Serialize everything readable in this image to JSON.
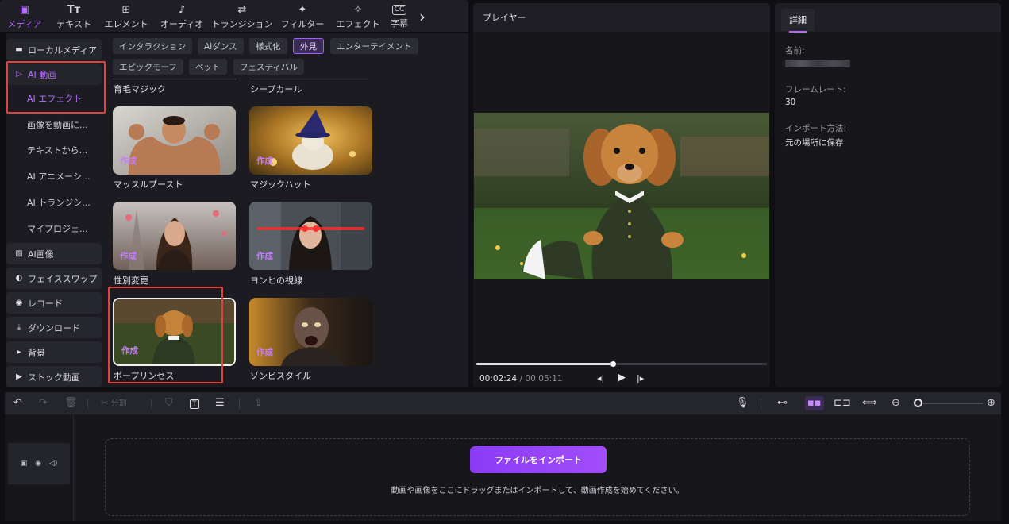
{
  "top_tabs": [
    {
      "icon": "media-icon",
      "glyph": "🖼",
      "label": "メディア",
      "active": true
    },
    {
      "icon": "text-icon",
      "glyph": "T",
      "label": "テキスト"
    },
    {
      "icon": "elements-icon",
      "glyph": "◫",
      "label": "エレメント"
    },
    {
      "icon": "audio-icon",
      "glyph": "♪",
      "label": "オーディオ"
    },
    {
      "icon": "transition-icon",
      "glyph": "⇆",
      "label": "トランジション"
    },
    {
      "icon": "filter-icon",
      "glyph": "✦",
      "label": "フィルター"
    },
    {
      "icon": "effect-icon",
      "glyph": "✧",
      "label": "エフェクト"
    },
    {
      "icon": "subtitle-icon",
      "glyph": "CC",
      "label": "字幕"
    }
  ],
  "sidebar": {
    "local_media": "ローカルメディア",
    "ai_video": "AI 動画",
    "ai_effect": "AI エフェクト",
    "image_to_video": "画像を動画に...",
    "text_to": "テキストから...",
    "ai_animation": "AI アニメーシ...",
    "ai_transition": "AI トランジシ...",
    "my_project": "マイプロジェ...",
    "ai_image": "AI画像",
    "face_swap": "フェイススワップ",
    "record": "レコード",
    "download": "ダウンロード",
    "background": "背景",
    "stock_video": "ストック動画"
  },
  "filters": {
    "row1": [
      "インタラクション",
      "AIダンス",
      "様式化",
      "外見",
      "エンターテイメント"
    ],
    "row2": [
      "エピックモーフ",
      "ペット",
      "フェスティバル"
    ],
    "selected": "外見"
  },
  "effects": {
    "top_labels": [
      "育毛マジック",
      "シープカール"
    ],
    "make_label": "作成",
    "items": [
      {
        "name": "マッスルブースト"
      },
      {
        "name": "マジックハット"
      },
      {
        "name": "性別変更"
      },
      {
        "name": "ヨンヒの視線"
      },
      {
        "name": "ポープリンセス"
      },
      {
        "name": "ゾンビスタイル"
      }
    ]
  },
  "player": {
    "title": "プレイヤー",
    "current_time": "00:02:24",
    "separator": "/",
    "total_time": "00:05:11",
    "progress": 0.47
  },
  "details": {
    "tab": "詳細",
    "name_label": "名前:",
    "framerate_label": "フレームレート:",
    "framerate_value": "30",
    "import_label": "インポート方法:",
    "import_value": "元の場所に保存"
  },
  "timeline": {
    "split_label": "分割",
    "import_button": "ファイルをインポート",
    "drop_hint": "動画や画像をここにドラッグまたはインポートして、動画作成を始めてください。",
    "zoom_level": 0.05
  },
  "colors": {
    "accent": "#b46cff",
    "highlight_box": "#e0433a"
  }
}
